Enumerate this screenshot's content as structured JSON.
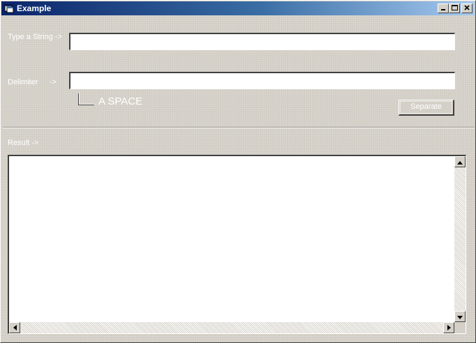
{
  "window": {
    "title": "Example",
    "icon": "app-window-icon",
    "controls": [
      "minimize-icon",
      "maximize-icon",
      "close-icon"
    ]
  },
  "form": {
    "string_label": "Type a String ->",
    "string_value": "",
    "delimiter_label": "Delimiter",
    "delimiter_arrow": "->",
    "delimiter_value": "",
    "delimiter_hint": "A SPACE",
    "separate_button": "Separate"
  },
  "result": {
    "label": "Result ->",
    "value": ""
  },
  "colors": {
    "face": "#d4d0c8",
    "title_start": "#0a246a",
    "title_end": "#a6caf0",
    "label_text": "#ffffff"
  }
}
